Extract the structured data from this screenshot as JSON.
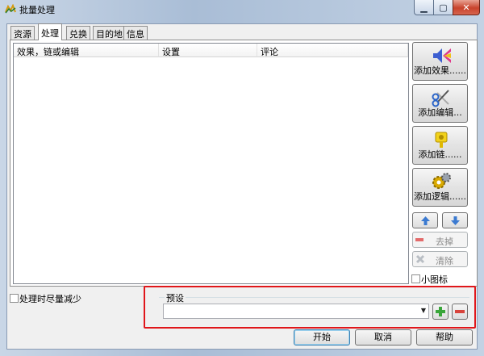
{
  "window": {
    "title": "批量处理",
    "close_label": "✕",
    "min_label": "▁",
    "max_label": "▢"
  },
  "tabs": [
    {
      "label": "资源"
    },
    {
      "label": "处理"
    },
    {
      "label": "兑换"
    },
    {
      "label": "目的地"
    },
    {
      "label": "信息"
    }
  ],
  "active_tab": "处理",
  "list": {
    "columns": [
      "效果，链或编辑",
      "设置",
      "评论"
    ],
    "rows": []
  },
  "side_buttons": {
    "add_effect": "添加效果......",
    "add_edit": "添加编辑...",
    "add_chain": "添加链......",
    "add_logic": "添加逻辑......",
    "remove": "去掉",
    "clear": "清除",
    "small_icons": "小图标"
  },
  "minimize_checkbox_label": "处理时尽量减少",
  "preset": {
    "label": "预设",
    "value": ""
  },
  "buttons": {
    "start": "开始",
    "cancel": "取消",
    "help": "帮助"
  },
  "colors": {
    "highlight": "#e0161a",
    "add_green": "#3aa63a",
    "remove_red": "#d8443c",
    "arrow_blue": "#3b7ad1"
  }
}
